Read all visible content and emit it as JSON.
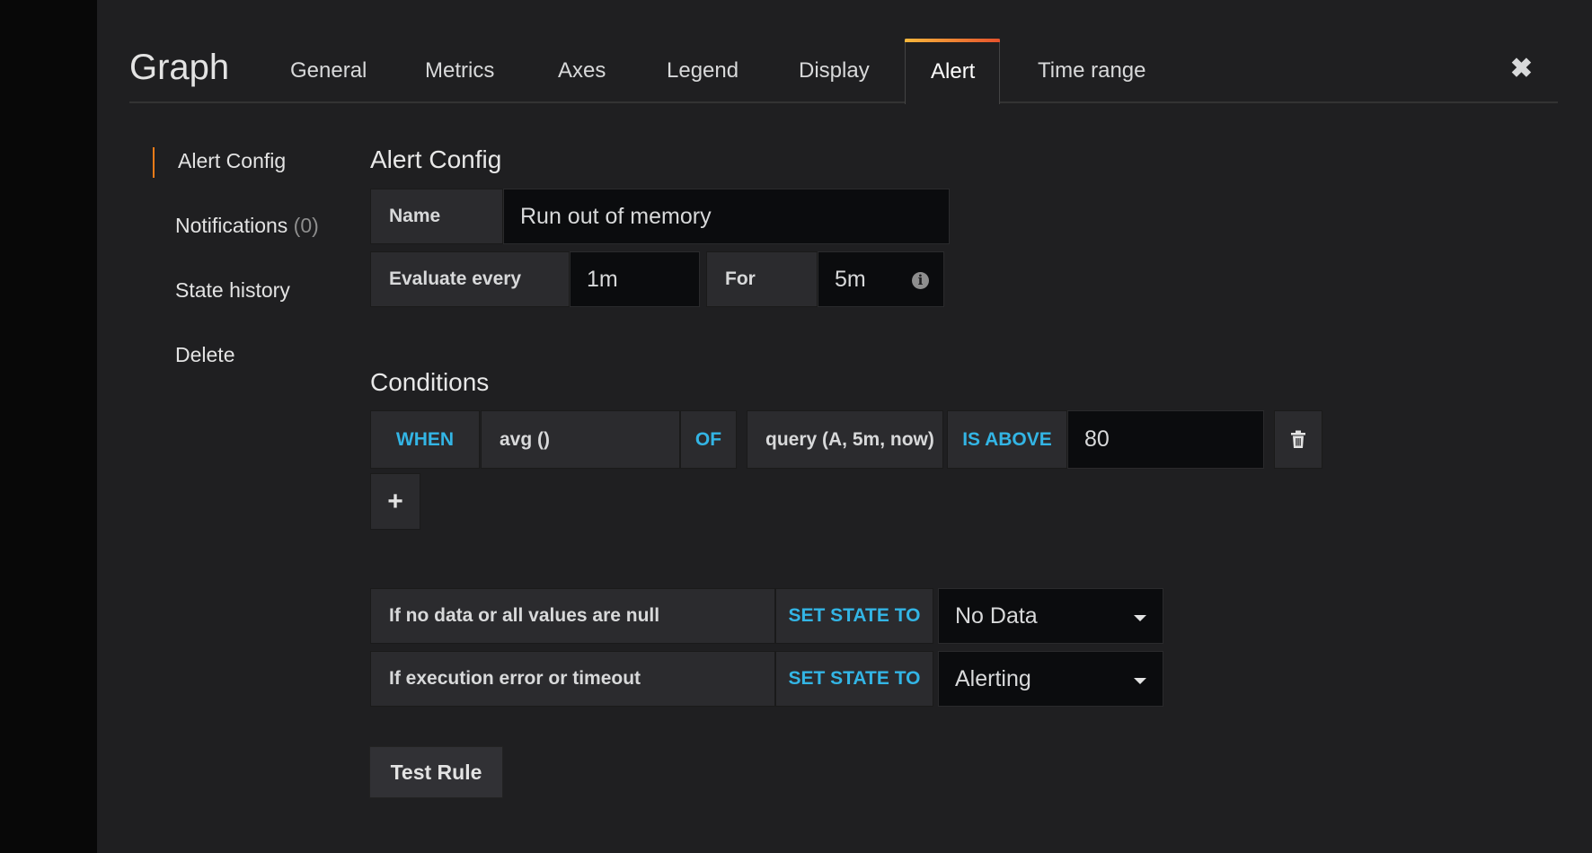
{
  "header": {
    "title": "Graph",
    "tabs": [
      "General",
      "Metrics",
      "Axes",
      "Legend",
      "Display",
      "Alert",
      "Time range"
    ],
    "active_tab": "Alert",
    "close_glyph": "✖"
  },
  "sidebar": {
    "items": [
      {
        "label": "Alert Config",
        "active": true
      },
      {
        "label": "Notifications",
        "count": "(0)"
      },
      {
        "label": "State history"
      },
      {
        "label": "Delete"
      }
    ]
  },
  "alert_config": {
    "heading": "Alert Config",
    "name_label": "Name",
    "name_value": "Run out of memory",
    "evaluate_label": "Evaluate every",
    "evaluate_value": "1m",
    "for_label": "For",
    "for_value": "5m",
    "info_glyph": "i"
  },
  "conditions": {
    "heading": "Conditions",
    "when": "WHEN",
    "reducer": "avg ()",
    "of": "OF",
    "query": "query (A, 5m, now)",
    "evaluator": "IS ABOVE",
    "threshold": "80",
    "add_glyph": "+"
  },
  "handling": {
    "no_data_label": "If no data or all values are null",
    "set_state_label": "SET STATE TO",
    "no_data_state": "No Data",
    "error_label": "If execution error or timeout",
    "error_state": "Alerting"
  },
  "test_rule_label": "Test Rule",
  "icons": {
    "close": "close-icon",
    "info": "info-icon",
    "trash": "trash-icon",
    "plus": "plus-icon",
    "caret": "caret-down-icon"
  },
  "colors": {
    "accent_blue": "#33b5e5",
    "active_marker": "#eb7b18",
    "tab_gradient_start": "#f6b73c",
    "tab_gradient_end": "#e6522c"
  }
}
